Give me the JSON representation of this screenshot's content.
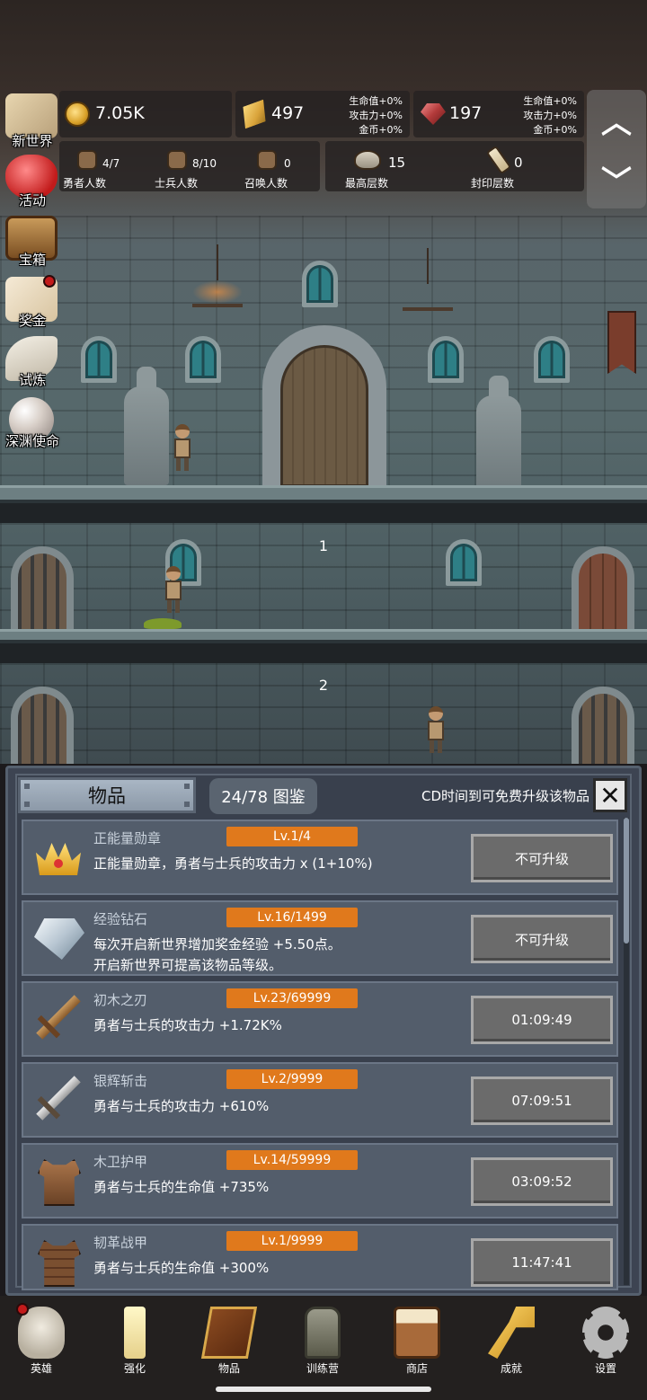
{
  "resources": {
    "coins": {
      "value": "7.05K"
    },
    "gold": {
      "value": "497",
      "bonus": [
        "生命值+0%",
        "攻击力+0%",
        "金币+0%"
      ]
    },
    "ruby": {
      "value": "197",
      "bonus": [
        "生命值+0%",
        "攻击力+0%",
        "金币+0%"
      ]
    }
  },
  "counts": {
    "heroes": {
      "value": "4/7",
      "label": "勇者人数"
    },
    "soldiers": {
      "value": "8/10",
      "label": "士兵人数"
    },
    "summons": {
      "value": "0",
      "label": "召唤人数"
    },
    "max_floor": {
      "value": "15",
      "label": "最高层数"
    },
    "sealed_floor": {
      "value": "0",
      "label": "封印层数"
    }
  },
  "nav_arrows": {
    "up": "︿",
    "down": "﹀"
  },
  "side_menu": [
    {
      "label": "新世界",
      "icon": "map-icon"
    },
    {
      "label": "活动",
      "icon": "heart-icon"
    },
    {
      "label": "宝箱",
      "icon": "chest-icon"
    },
    {
      "label": "奖金",
      "icon": "envelope-icon"
    },
    {
      "label": "试炼",
      "icon": "feather-icon"
    },
    {
      "label": "深渊使命",
      "icon": "orb-icon"
    }
  ],
  "floors": [
    {
      "number": "1"
    },
    {
      "number": "2"
    }
  ],
  "items_panel": {
    "title": "物品",
    "atlas": "24/78 图鉴",
    "notice": "CD时间到可免费升级该物品",
    "close": "✕",
    "items": [
      {
        "name": "正能量勋章",
        "level": "Lv.1/4",
        "desc": [
          "正能量勋章，勇者与士兵的攻击力 x (1+10%)"
        ],
        "button": "不可升级",
        "icon": "crown-icon"
      },
      {
        "name": "经验钻石",
        "level": "Lv.16/1499",
        "desc": [
          "每次开启新世界增加奖金经验 +5.50点。",
          "开启新世界可提高该物品等级。"
        ],
        "button": "不可升级",
        "icon": "diamond-icon"
      },
      {
        "name": "初木之刃",
        "level": "Lv.23/69999",
        "desc": [
          "勇者与士兵的攻击力 +1.72K%"
        ],
        "button": "01:09:49",
        "icon": "wooden-sword-icon"
      },
      {
        "name": "银辉斩击",
        "level": "Lv.2/9999",
        "desc": [
          "勇者与士兵的攻击力 +610%"
        ],
        "button": "07:09:51",
        "icon": "silver-sword-icon"
      },
      {
        "name": "木卫护甲",
        "level": "Lv.14/59999",
        "desc": [
          "勇者与士兵的生命值 +735%"
        ],
        "button": "03:09:52",
        "icon": "wooden-armor-icon"
      },
      {
        "name": "韧革战甲",
        "level": "Lv.1/9999",
        "desc": [
          "勇者与士兵的生命值 +300%"
        ],
        "button": "11:47:41",
        "icon": "leather-armor-icon"
      }
    ]
  },
  "bottom_nav": [
    {
      "label": "英雄",
      "icon": "skull-icon"
    },
    {
      "label": "强化",
      "icon": "candle-icon"
    },
    {
      "label": "物品",
      "icon": "book-icon"
    },
    {
      "label": "训练营",
      "icon": "lantern-icon"
    },
    {
      "label": "商店",
      "icon": "mug-icon"
    },
    {
      "label": "成就",
      "icon": "key-icon"
    },
    {
      "label": "设置",
      "icon": "gear-icon"
    }
  ],
  "colors": {
    "level_badge": "#e0791c",
    "panel_bg": "#3d4452",
    "row_bg": "#535d6b",
    "notification_dot": "#c21b1b"
  }
}
